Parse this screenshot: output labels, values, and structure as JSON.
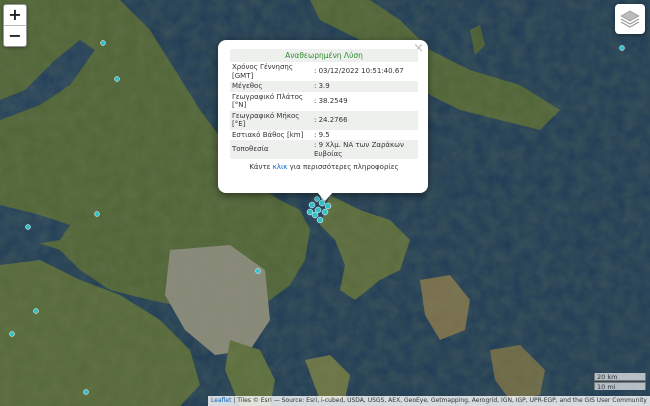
{
  "map": {
    "zoom_in_label": "+",
    "zoom_out_label": "−",
    "layers_icon": "layers-stack-icon",
    "colors": {
      "sea": "#1d3a55",
      "land": "#4d6236",
      "urban": "#8a8a80",
      "marker": "#35c0c8"
    }
  },
  "popup": {
    "title": "Αναθεωρημένη Λύση",
    "close_label": "×",
    "rows": [
      {
        "label": "Χρόνος Γέννησης [GMT]",
        "value": ": 03/12/2022 10:51:40.67"
      },
      {
        "label": "Μέγεθος",
        "value": ": 3.9"
      },
      {
        "label": "Γεωγραφικό Πλάτος [°N]",
        "value": ": 38.2549"
      },
      {
        "label": "Γεωγραφικό Μήκος [°E]",
        "value": ": 24.2766"
      },
      {
        "label": "Εστιακό Βάθος [km]",
        "value": ": 9.5"
      },
      {
        "label": "Τοποθεσία",
        "value": ": 9 Χλμ. ΝΑ των Ζαράκων Ευβοίας"
      }
    ],
    "footer_prefix": "Κάντε ",
    "footer_link": "κλικ",
    "footer_suffix": " για περισσότερες πληροφορίες"
  },
  "scale": {
    "metric": "20 km",
    "imperial": "10 mi"
  },
  "attribution": {
    "leaflet": "Leaflet",
    "tiles": "| Tiles © Esri — Source: Esri, i-cubed, USDA, USGS, AEX, GeoEye, Getmapping, Aerogrid, IGN, IGP, UPR-EGP, and the GIS User Community"
  }
}
